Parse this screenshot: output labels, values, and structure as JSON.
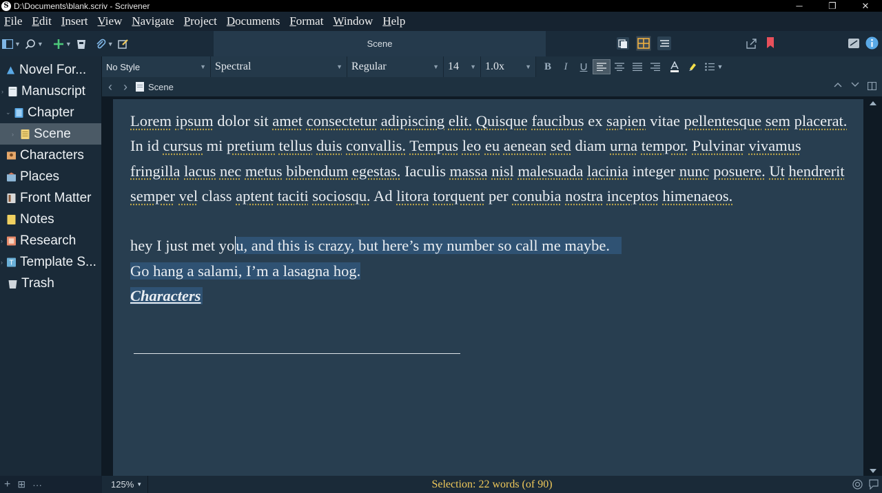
{
  "window": {
    "title": "D:\\Documents\\blank.scriv - Scrivener",
    "app_icon": "S",
    "minimize": "─",
    "restore": "❐",
    "close": "✕"
  },
  "menu": [
    "File",
    "Edit",
    "Insert",
    "View",
    "Navigate",
    "Project",
    "Documents",
    "Format",
    "Window",
    "Help"
  ],
  "toolbar": {
    "document_title": "Scene"
  },
  "binder": {
    "items": [
      {
        "label": "Novel For...",
        "icon": "project-icon",
        "color": "#5aa9e6"
      },
      {
        "label": "Manuscript",
        "icon": "manuscript-icon",
        "color": "#e8eef4"
      },
      {
        "label": "Chapter",
        "icon": "folder-icon",
        "color": "#5aa9e6"
      },
      {
        "label": "Scene",
        "icon": "scene-document-icon",
        "color": "#f0d27a"
      },
      {
        "label": "Characters",
        "icon": "characters-icon",
        "color": "#e6a86a"
      },
      {
        "label": "Places",
        "icon": "places-icon",
        "color": "#8fb8d8"
      },
      {
        "label": "Front Matter",
        "icon": "front-matter-icon",
        "color": "#d9d9d9"
      },
      {
        "label": "Notes",
        "icon": "notes-icon",
        "color": "#f0d060"
      },
      {
        "label": "Research",
        "icon": "research-icon",
        "color": "#e88a6a"
      },
      {
        "label": "Template S...",
        "icon": "template-icon",
        "color": "#6ab0d8"
      },
      {
        "label": "Trash",
        "icon": "trash-icon",
        "color": "#d0d6dc"
      }
    ],
    "footer": {
      "add": "+",
      "add_doc": "⊞",
      "more": "···"
    }
  },
  "format": {
    "style": "No Style",
    "font": "Spectral",
    "weight": "Regular",
    "size": "14",
    "spacing": "1.0x",
    "bold": "B",
    "italic": "I",
    "underline": "U"
  },
  "header": {
    "back": "‹",
    "forward": "›",
    "title": "Scene"
  },
  "document": {
    "paragraph1_words": [
      {
        "t": "Lorem",
        "u": true
      },
      {
        "t": "ipsum",
        "u": true
      },
      {
        "t": "dolor",
        "u": false
      },
      {
        "t": "sit",
        "u": false
      },
      {
        "t": "amet",
        "u": true
      },
      {
        "t": "consectetur",
        "u": true
      },
      {
        "t": "adipiscing",
        "u": true
      },
      {
        "t": "elit.",
        "u": true
      },
      {
        "t": "Quisque",
        "u": true
      },
      {
        "t": "faucibus",
        "u": true
      },
      {
        "t": "ex",
        "u": false
      },
      {
        "t": "sapien",
        "u": true
      },
      {
        "t": "vitae",
        "u": false
      },
      {
        "t": "pellentesque",
        "u": true
      },
      {
        "t": "sem",
        "u": true
      },
      {
        "t": "placerat.",
        "u": true
      },
      {
        "t": "In",
        "u": false
      },
      {
        "t": "id",
        "u": false
      },
      {
        "t": "cursus",
        "u": true
      },
      {
        "t": "mi",
        "u": false
      },
      {
        "t": "pretium",
        "u": true
      },
      {
        "t": "tellus",
        "u": true
      },
      {
        "t": "duis",
        "u": true
      },
      {
        "t": "convallis.",
        "u": true
      },
      {
        "t": "Tempus",
        "u": true
      },
      {
        "t": "leo",
        "u": true
      },
      {
        "t": "eu",
        "u": true
      },
      {
        "t": "aenean",
        "u": true
      },
      {
        "t": "sed",
        "u": true
      },
      {
        "t": "diam",
        "u": false
      },
      {
        "t": "urna",
        "u": true
      },
      {
        "t": "tempor.",
        "u": true
      },
      {
        "t": "Pulvinar",
        "u": true
      },
      {
        "t": "vivamus",
        "u": true
      },
      {
        "t": "fringilla",
        "u": true
      },
      {
        "t": "lacus",
        "u": true
      },
      {
        "t": "nec",
        "u": true
      },
      {
        "t": "metus",
        "u": true
      },
      {
        "t": "bibendum",
        "u": true
      },
      {
        "t": "egestas.",
        "u": true
      },
      {
        "t": "Iaculis",
        "u": false
      },
      {
        "t": "massa",
        "u": true
      },
      {
        "t": "nisl",
        "u": true
      },
      {
        "t": "malesuada",
        "u": true
      },
      {
        "t": "lacinia",
        "u": true
      },
      {
        "t": "integer",
        "u": false
      },
      {
        "t": "nunc",
        "u": true
      },
      {
        "t": "posuere.",
        "u": true
      },
      {
        "t": "Ut",
        "u": true
      },
      {
        "t": "hendrerit",
        "u": true
      },
      {
        "t": "semper",
        "u": true
      },
      {
        "t": "vel",
        "u": true
      },
      {
        "t": "class",
        "u": false
      },
      {
        "t": "aptent",
        "u": true
      },
      {
        "t": "taciti",
        "u": true
      },
      {
        "t": "sociosqu.",
        "u": true
      },
      {
        "t": "Ad",
        "u": false
      },
      {
        "t": "litora",
        "u": true
      },
      {
        "t": "torquent",
        "u": true
      },
      {
        "t": "per",
        "u": false
      },
      {
        "t": "conubia",
        "u": true
      },
      {
        "t": "nostra",
        "u": true
      },
      {
        "t": "inceptos",
        "u": true
      },
      {
        "t": "himenaeos.",
        "u": true
      }
    ],
    "line2_before_caret": "hey I just met yo",
    "line2_selected": "u, and this is crazy, but here’s my number so call me maybe.",
    "line3": "Go hang a salami, I’m a lasagna hog.",
    "link": "Characters"
  },
  "status": {
    "zoom": "125%",
    "selection": "Selection: 22 words (of 90)"
  },
  "colors": {
    "accent_bookmark": "#e8505b",
    "selection": "#2f5273",
    "status_text": "#f0c95a"
  }
}
